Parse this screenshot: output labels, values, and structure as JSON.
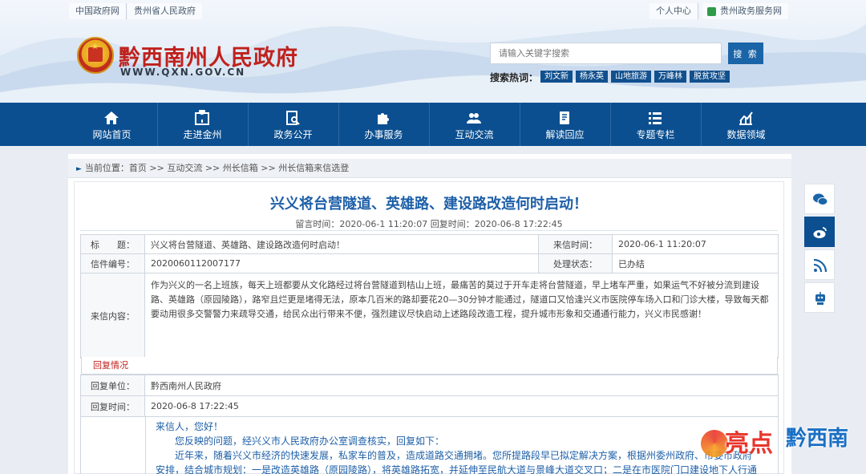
{
  "topbar": {
    "links_left": [
      "中国政府网",
      "贵州省人民政府"
    ],
    "links_right": [
      "个人中心",
      "贵州政务服务网"
    ]
  },
  "site": {
    "title": "黔西南州人民政府",
    "url": "WWW.QXN.GOV.CN"
  },
  "search": {
    "placeholder": "请输入关键字搜索",
    "button": "搜 索",
    "hot_label": "搜索热词：",
    "hot_words": [
      "刘文新",
      "杨永英",
      "山地旅游",
      "万峰林",
      "脱贫攻坚"
    ]
  },
  "nav": [
    {
      "label": "网站首页",
      "icon": "home-icon"
    },
    {
      "label": "走进金州",
      "icon": "map-pin-icon"
    },
    {
      "label": "政务公开",
      "icon": "search-doc-icon"
    },
    {
      "label": "办事服务",
      "icon": "puzzle-icon"
    },
    {
      "label": "互动交流",
      "icon": "people-icon"
    },
    {
      "label": "解读回应",
      "icon": "document-icon"
    },
    {
      "label": "专题专栏",
      "icon": "list-icon"
    },
    {
      "label": "数据领域",
      "icon": "chart-icon"
    }
  ],
  "breadcrumb": "当前位置：首页 >> 互动交流 >> 州长信箱 >> 州长信箱来信选登",
  "article": {
    "title": "兴义将台营隧道、英雄路、建设路改造何时启动！",
    "time_line": "留言时间：2020-06-1 11:20:07 回复时间：2020-06-8 17:22:45"
  },
  "letter": {
    "title_label": "标　　题：",
    "title_value": "兴义将台营隧道、英雄路、建设路改造何时启动！",
    "sent_label": "来信时间：",
    "sent_value": "2020-06-1 11:20:07",
    "id_label": "信件编号：",
    "id_value": "2020060112007177",
    "status_label": "处理状态：",
    "status_value": "已办结",
    "content_label": "来信内容：",
    "content_value": "作为兴义的一名上班族，每天上班都要从文化路经过将台营隧道到桔山上班，最痛苦的莫过于开车走将台营隧道，早上堵车严重，如果运气不好被分流到建设路、英雄路（原园陵路），路窄且烂更是堵得无法，原本几百米的路却要花20—30分钟才能通过，隧道口又恰逢兴义市医院停车场入口和门诊大楼，导致每天都要动用很多交警警力来疏导交通，给民众出行带来不便，强烈建议尽快启动上述路段改造工程，提升城市形象和交通通行能力，兴义市民感谢！"
  },
  "reply": {
    "heading": "回复情况",
    "unit_label": "回复单位：",
    "unit_value": "黔西南州人民政府",
    "time_label": "回复时间：",
    "time_value": "2020-06-8 17:22:45",
    "greeting": "来信人，您好！",
    "para1": "您反映的问题，经兴义市人民政府办公室调查核实，回复如下：",
    "para2": "近年来，随着兴义市经济的快速发展，私家车的普及，造成道路交通拥堵。您所提路段早已拟定解决方案，根据州委州政府、市委市政府",
    "para3": "安排，结合城市规划：一是改造英雄路（原园陵路），将英雄路拓宽，并延伸至民航大道与景峰大道交叉口；二是在市医院门口建设地下人行通"
  },
  "side": [
    "wechat-icon",
    "weibo-icon",
    "rss-icon",
    "robot-icon"
  ],
  "watermark": {
    "part1": "亮点",
    "part2": "黔西南"
  },
  "colors": {
    "nav": "#0b4f90",
    "title": "#1d5fa8",
    "brand_red": "#c0211d"
  }
}
